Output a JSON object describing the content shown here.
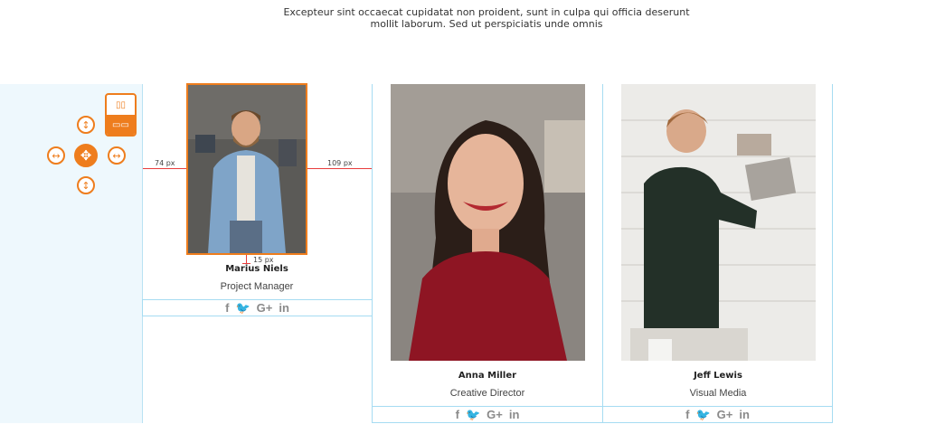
{
  "intro": {
    "line1": "Excepteur sint occaecat cupidatat non proident, sunt in culpa qui officia deserunt",
    "line2": "mollit laborum. Sed ut perspiciatis unde omnis"
  },
  "editor": {
    "measure_left": "74 px",
    "measure_right": "109 px",
    "measure_bottom": "15  px",
    "accent": "#ee7d1d",
    "guide_color": "#e83c3c"
  },
  "team": [
    {
      "name": "Marius Niels",
      "role": "Project Manager"
    },
    {
      "name": "Anna Miller",
      "role": "Creative Director"
    },
    {
      "name": "Jeff Lewis",
      "role": "Visual Media"
    }
  ],
  "social": {
    "facebook": "f",
    "twitter": "🐦",
    "google": "G+",
    "linkedin": "in"
  }
}
